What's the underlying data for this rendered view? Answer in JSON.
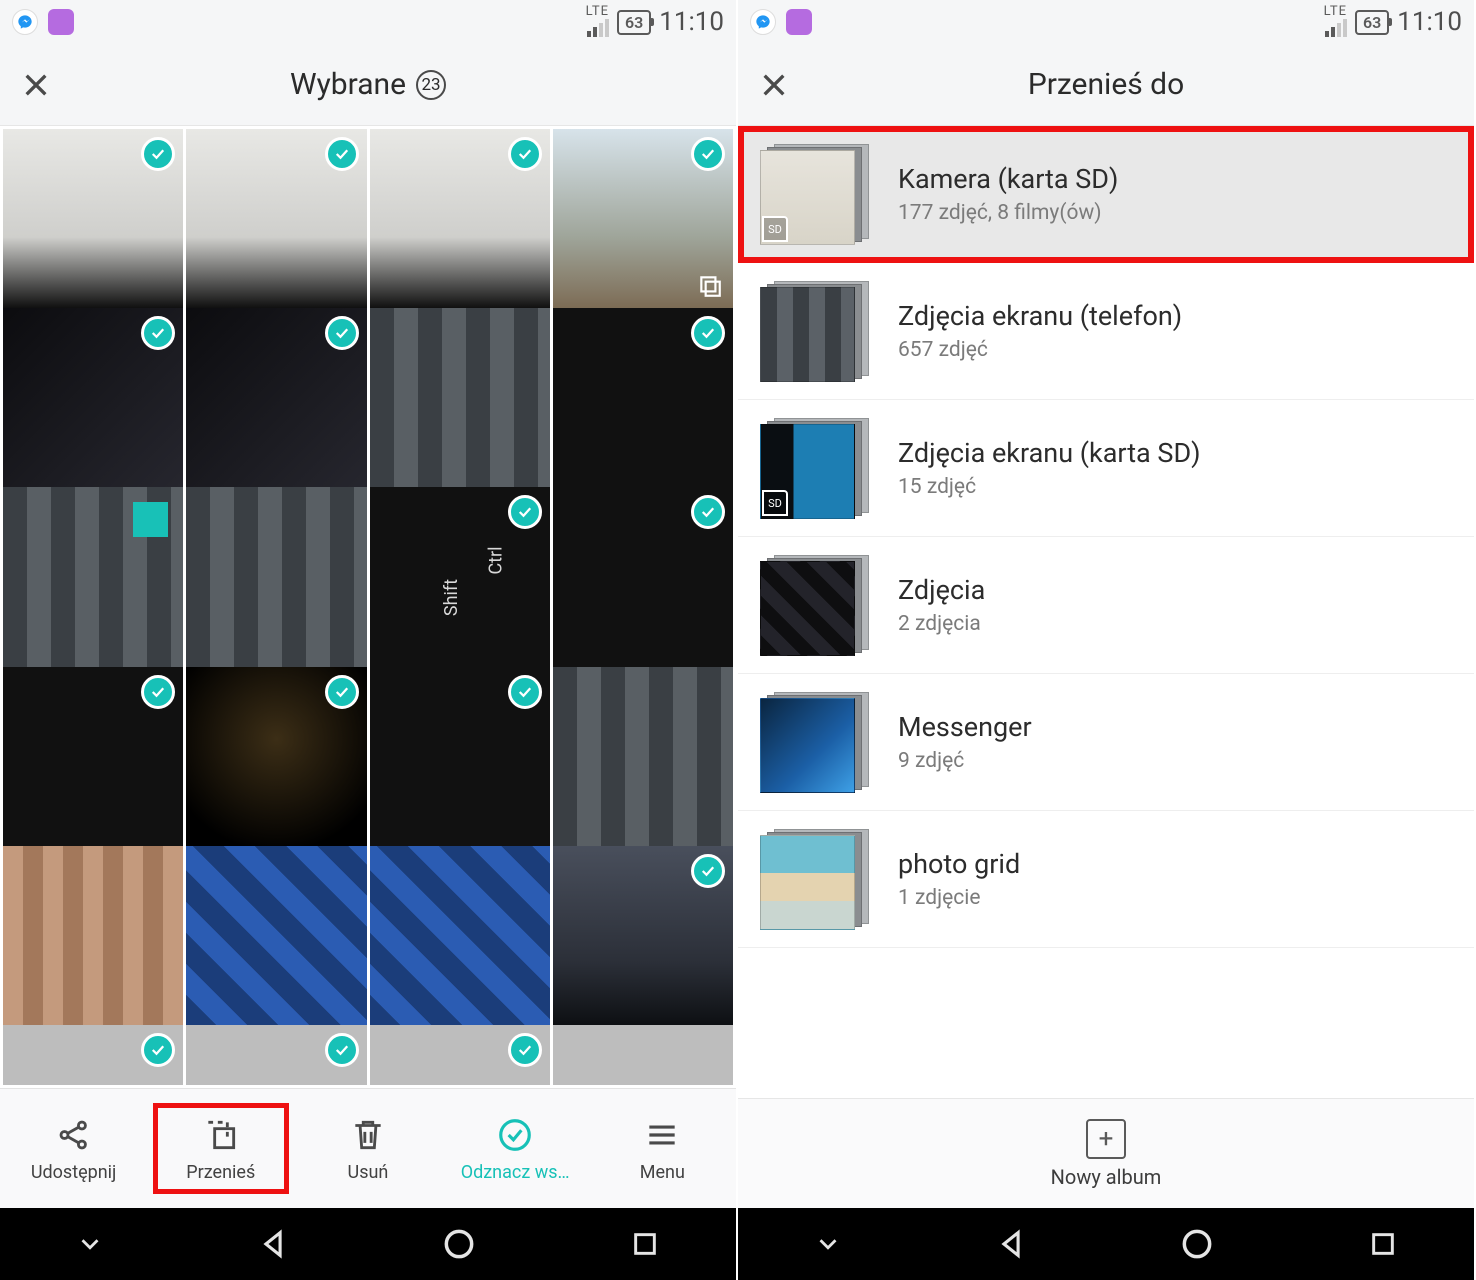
{
  "status": {
    "lte": "LTE",
    "battery": "63",
    "time": "11:10"
  },
  "left": {
    "title": "Wybrane",
    "count": "23",
    "toolbar": {
      "share": "Udostępnij",
      "move": "Przenieś",
      "delete": "Usuń",
      "deselect": "Odznacz ws…",
      "menu": "Menu"
    }
  },
  "right": {
    "title": "Przenieś do",
    "albums": [
      {
        "title": "Kamera (karta SD)",
        "sub": "177 zdjęć,  8 filmy(ów)",
        "sd": true,
        "cls": "doc-thumb",
        "hl": true
      },
      {
        "title": "Zdjęcia ekranu (telefon)",
        "sub": "657 zdjęć",
        "sd": false,
        "cls": "pix-thumb",
        "hl": false
      },
      {
        "title": "Zdjęcia ekranu (karta SD)",
        "sub": "15 zdjęć",
        "sd": true,
        "cls": "screen-thumb",
        "hl": false
      },
      {
        "title": "Zdjęcia",
        "sub": "2 zdjęcia",
        "sd": false,
        "cls": "kb-thumb",
        "hl": false
      },
      {
        "title": "Messenger",
        "sub": "9 zdjęć",
        "sd": false,
        "cls": "mess-thumb",
        "hl": false
      },
      {
        "title": "photo grid",
        "sub": "1 zdjęcie",
        "sd": false,
        "cls": "pg-thumb",
        "hl": false
      }
    ],
    "new_album": "Nowy album"
  },
  "grid_cells": [
    {
      "cls": "controller",
      "check": true
    },
    {
      "cls": "controller",
      "check": true
    },
    {
      "cls": "controller",
      "check": true
    },
    {
      "cls": "construction",
      "check": true,
      "stack": true
    },
    {
      "cls": "keyboard",
      "check": true
    },
    {
      "cls": "keyboard",
      "check": true
    },
    {
      "cls": "pixeled",
      "check": false
    },
    {
      "cls": "dark-text",
      "check": true
    },
    {
      "cls": "pixeled teal-accent",
      "check": false
    },
    {
      "cls": "pixeled",
      "check": false
    },
    {
      "cls": "shift-ctrl",
      "check": true
    },
    {
      "cls": "dark-text",
      "check": true
    },
    {
      "cls": "dark-text",
      "check": true
    },
    {
      "cls": "warm-dark",
      "check": true
    },
    {
      "cls": "dark-text",
      "check": true
    },
    {
      "cls": "pixeled",
      "check": false
    },
    {
      "cls": "skin-pix",
      "check": false
    },
    {
      "cls": "blue-pix",
      "check": false
    },
    {
      "cls": "blue-pix",
      "check": false
    },
    {
      "cls": "sunset",
      "check": true
    },
    {
      "cls": "light",
      "check": true,
      "cut": true
    },
    {
      "cls": "light",
      "check": true,
      "cut": true
    },
    {
      "cls": "light",
      "check": true,
      "cut": true
    },
    {
      "cls": "light",
      "check": false,
      "cut": true
    }
  ]
}
